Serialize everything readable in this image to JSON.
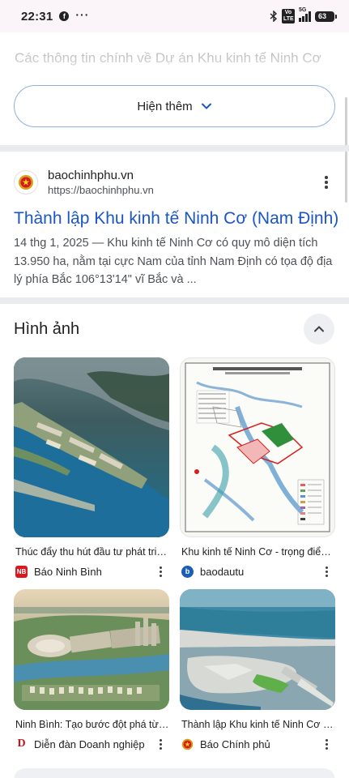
{
  "status_bar": {
    "time": "22:31",
    "battery": "63",
    "network": "5G",
    "volte": "Vo LTE"
  },
  "faded_heading": "Các thông tin chính về Dự án Khu kinh tế Ninh Cơ",
  "show_more": {
    "label": "Hiện thêm",
    "icon": "chevron-down-icon"
  },
  "result": {
    "site_name": "baochinhphu.vn",
    "url": "https://baochinhphu.vn",
    "title": "Thành lập Khu kinh tế Ninh Cơ (Nam Định)",
    "snippet": "14 thg 1, 2025 — Khu kinh tế Ninh Cơ có quy mô diện tích 13.950 ha, nằm tại cực Nam của tỉnh Nam Định có tọa độ địa lý phía Bắc 106°13'14\" vĩ Bắc và ..."
  },
  "images": {
    "title": "Hình ảnh",
    "items": [
      {
        "caption": "Thúc đẩy thu hút đầu tư phát triển Khu kinh tế Ninh Cơ",
        "source": "Báo Ninh Bình",
        "source_icon": "NB",
        "source_color": "#d71920"
      },
      {
        "caption": "Khu kinh tế Ninh Cơ - trọng điểm phát triển",
        "source": "baodautu",
        "source_icon": "b",
        "source_color": "#1a5fb4"
      },
      {
        "caption": "Ninh Bình: Tạo bước đột phá từ Khu kinh tế Ninh Cơ",
        "source": "Diễn đàn Doanh nghiệp",
        "source_icon": "D",
        "source_color": "#c4161c"
      },
      {
        "caption": "Thành lập Khu kinh tế Ninh Cơ (Nam Định)",
        "source": "Báo Chính phủ",
        "source_icon": "emblem",
        "source_color": "#d4a017"
      }
    ]
  }
}
